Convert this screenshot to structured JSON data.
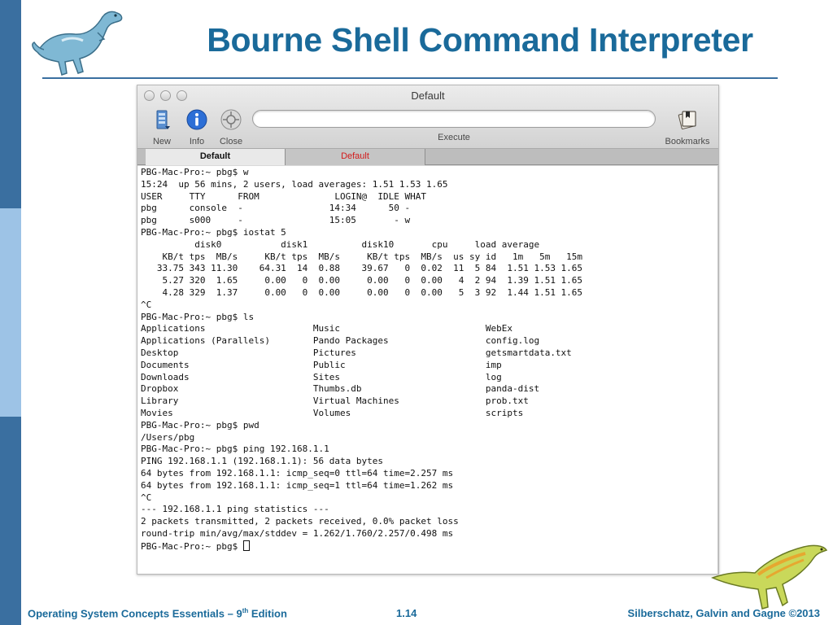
{
  "slide": {
    "title": "Bourne Shell Command Interpreter",
    "footer_left_pre": "Operating System Concepts Essentials – 9",
    "footer_left_sup": "th",
    "footer_left_post": " Edition",
    "footer_page": "1.14",
    "footer_right": "Silberschatz, Galvin and Gagne ©2013"
  },
  "window": {
    "title": "Default",
    "toolbar": {
      "new_label": "New",
      "info_label": "Info",
      "close_label": "Close",
      "execute_label": "Execute",
      "bookmarks_label": "Bookmarks",
      "command_value": ""
    },
    "tabs": [
      {
        "label": "Default"
      },
      {
        "label": "Default"
      }
    ]
  },
  "terminal": {
    "lines": [
      "PBG-Mac-Pro:~ pbg$ w",
      "15:24  up 56 mins, 2 users, load averages: 1.51 1.53 1.65",
      "USER     TTY      FROM              LOGIN@  IDLE WHAT",
      "pbg      console  -                14:34      50 -",
      "pbg      s000     -                15:05       - w",
      "PBG-Mac-Pro:~ pbg$ iostat 5",
      "          disk0           disk1          disk10       cpu     load average",
      "    KB/t tps  MB/s     KB/t tps  MB/s     KB/t tps  MB/s  us sy id   1m   5m   15m",
      "   33.75 343 11.30    64.31  14  0.88    39.67   0  0.02  11  5 84  1.51 1.53 1.65",
      "    5.27 320  1.65     0.00   0  0.00     0.00   0  0.00   4  2 94  1.39 1.51 1.65",
      "    4.28 329  1.37     0.00   0  0.00     0.00   0  0.00   5  3 92  1.44 1.51 1.65",
      "^C",
      "PBG-Mac-Pro:~ pbg$ ls",
      "Applications                    Music                           WebEx",
      "Applications (Parallels)        Pando Packages                  config.log",
      "Desktop                         Pictures                        getsmartdata.txt",
      "Documents                       Public                          imp",
      "Downloads                       Sites                           log",
      "Dropbox                         Thumbs.db                       panda-dist",
      "Library                         Virtual Machines                prob.txt",
      "Movies                          Volumes                         scripts",
      "PBG-Mac-Pro:~ pbg$ pwd",
      "/Users/pbg",
      "PBG-Mac-Pro:~ pbg$ ping 192.168.1.1",
      "PING 192.168.1.1 (192.168.1.1): 56 data bytes",
      "64 bytes from 192.168.1.1: icmp_seq=0 ttl=64 time=2.257 ms",
      "64 bytes from 192.168.1.1: icmp_seq=1 ttl=64 time=1.262 ms",
      "^C",
      "--- 192.168.1.1 ping statistics ---",
      "2 packets transmitted, 2 packets received, 0.0% packet loss",
      "round-trip min/avg/max/stddev = 1.262/1.760/2.257/0.498 ms"
    ],
    "prompt": "PBG-Mac-Pro:~ pbg$ "
  },
  "colors": {
    "title": "#1a6a9a",
    "sidebar": "#3a6fa0",
    "tab_inactive_text": "#d21a1a"
  }
}
